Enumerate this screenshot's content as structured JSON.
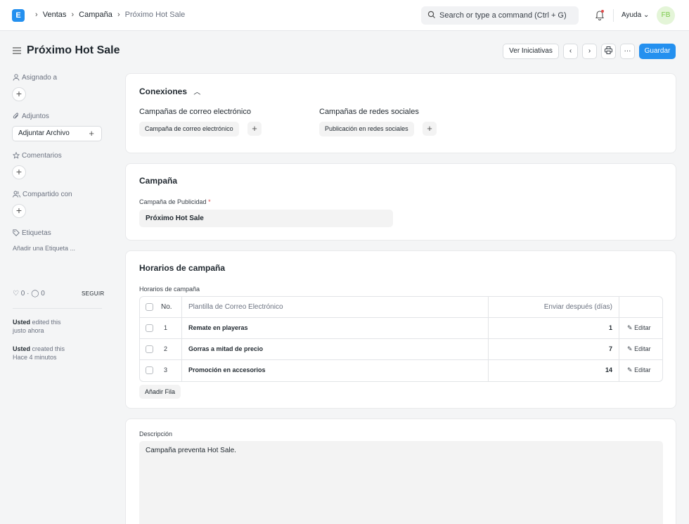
{
  "navbar": {
    "logo_letter": "E",
    "breadcrumbs": [
      "Ventas",
      "Campaña",
      "Próximo Hot Sale"
    ],
    "search_placeholder": "Search or type a command (Ctrl + G)",
    "help_label": "Ayuda",
    "avatar_initials": "FB"
  },
  "header": {
    "title": "Próximo Hot Sale",
    "view_initiatives_label": "Ver Iniciativas",
    "more_label": "···",
    "save_label": "Guardar"
  },
  "sidebar": {
    "assigned_label": "Asignado a",
    "attachments_label": "Adjuntos",
    "attach_file_label": "Adjuntar Archivo",
    "comments_label": "Comentarios",
    "shared_label": "Compartido con",
    "tags_label": "Etiquetas",
    "add_tag_label": "Añadir una Etiqueta ...",
    "likes_count": "0",
    "comments_count": "0",
    "follow_label": "SEGUIR",
    "activity": [
      {
        "user": "Usted",
        "action": " edited this",
        "time": "justo ahora"
      },
      {
        "user": "Usted",
        "action": " created this",
        "time": "Hace 4 minutos"
      }
    ]
  },
  "connections": {
    "title": "Conexiones",
    "email_campaigns_label": "Campañas de correo electrónico",
    "email_campaign_pill": "Campaña de correo electrónico",
    "social_campaigns_label": "Campañas de redes sociales",
    "social_post_pill": "Publicación en redes sociales"
  },
  "campaign": {
    "title": "Campaña",
    "field_label": "Campaña de Publicidad",
    "required_mark": "*",
    "field_value": "Próximo Hot Sale"
  },
  "schedules": {
    "title": "Horarios de campaña",
    "table_label": "Horarios de campaña",
    "columns": {
      "no": "No.",
      "template": "Plantilla de Correo Electrónico",
      "days": "Enviar después (días)"
    },
    "rows": [
      {
        "no": "1",
        "template": "Remate en playeras",
        "days": "1",
        "edit": "Editar"
      },
      {
        "no": "2",
        "template": "Gorras a mitad de precio",
        "days": "7",
        "edit": "Editar"
      },
      {
        "no": "3",
        "template": "Promoción en accesorios",
        "days": "14",
        "edit": "Editar"
      }
    ],
    "add_row_label": "Añadir Fila"
  },
  "description": {
    "label": "Descripción",
    "value": "Campaña preventa Hot Sale."
  },
  "colors": {
    "primary": "#2490ef",
    "avatar_bg": "#e4f5d8",
    "avatar_text": "#7bc94a",
    "required": "#e24c4c"
  }
}
